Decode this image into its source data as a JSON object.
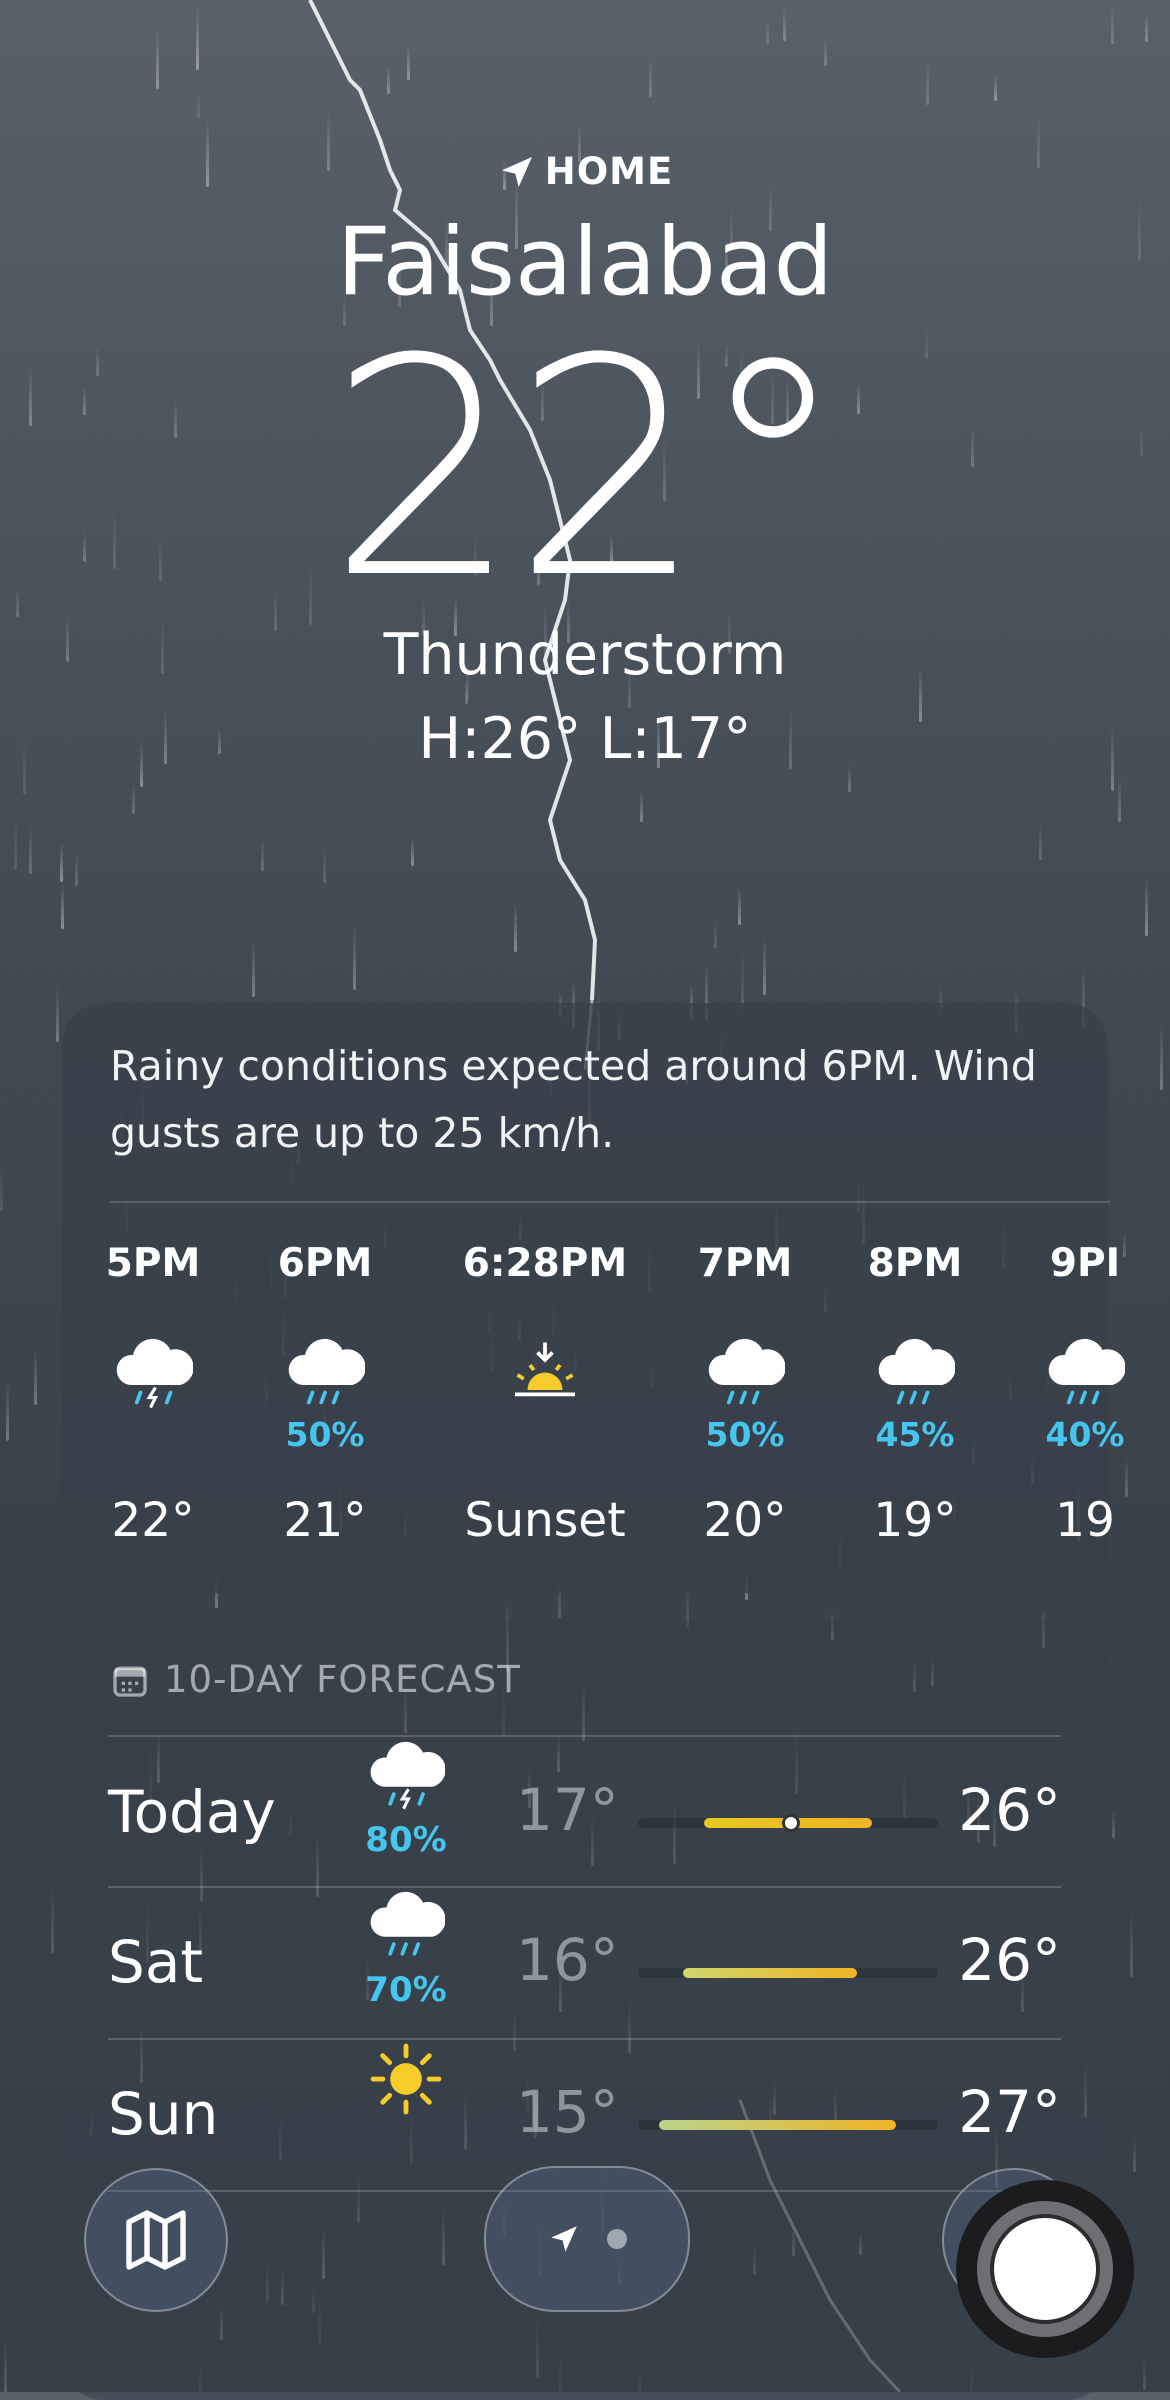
{
  "header": {
    "location_label": "HOME",
    "city": "Faisalabad",
    "temperature": "22°",
    "condition": "Thunderstorm",
    "high_low": "H:26°  L:17°"
  },
  "hourly": {
    "summary": "Rainy conditions expected around 6PM. Wind gusts are up to 25 km/h.",
    "items": [
      {
        "time": "5PM",
        "icon": "thunderstorm-icon",
        "precip": "",
        "value": "22°"
      },
      {
        "time": "6PM",
        "icon": "rain-cloud-icon",
        "precip": "50%",
        "value": "21°"
      },
      {
        "time": "6:28PM",
        "icon": "sunset-icon",
        "precip": "",
        "value": "Sunset"
      },
      {
        "time": "7PM",
        "icon": "rain-cloud-icon",
        "precip": "50%",
        "value": "20°"
      },
      {
        "time": "8PM",
        "icon": "rain-cloud-icon",
        "precip": "45%",
        "value": "19°"
      },
      {
        "time": "9PI",
        "icon": "rain-cloud-icon",
        "precip": "40%",
        "value": "19"
      }
    ]
  },
  "forecast": {
    "title": "10-DAY FORECAST",
    "days": [
      {
        "day": "Today",
        "icon": "thunderstorm-icon",
        "precip": "80%",
        "low": "17°",
        "high": "26°",
        "range_start": 0.22,
        "range_end": 0.78,
        "current": 0.51,
        "grad": "#e8c91f,#f1b324"
      },
      {
        "day": "Sat",
        "icon": "rain-cloud-icon",
        "precip": "70%",
        "low": "16°",
        "high": "26°",
        "range_start": 0.15,
        "range_end": 0.73,
        "grad": "#cfd56c,#f0b526"
      },
      {
        "day": "Sun",
        "icon": "sun-icon",
        "precip": "",
        "low": "15°",
        "high": "27°",
        "range_start": 0.07,
        "range_end": 0.86,
        "grad": "#b9d48a,#f0b526"
      }
    ]
  },
  "colors": {
    "precip": "#46c6ee",
    "sun": "#f5cc2a",
    "background": "#424a54"
  }
}
